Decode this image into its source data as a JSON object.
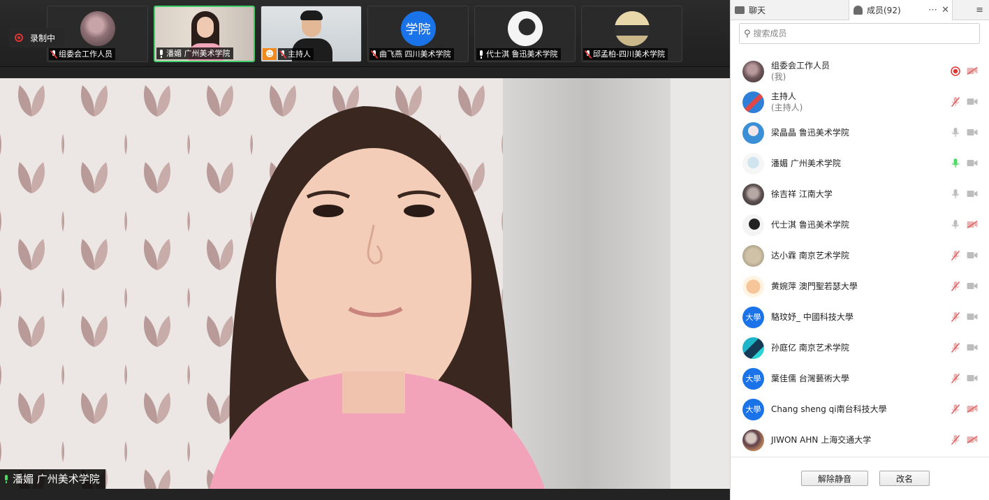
{
  "recording": {
    "label": "录制中"
  },
  "thumbnails": [
    {
      "name": "组委会工作人员",
      "mic": "muted",
      "avatar": "photo-dark"
    },
    {
      "name": "潘媚 广州美术学院",
      "mic": "on",
      "avatar": "photo-woman",
      "active": true
    },
    {
      "name": "主持人",
      "mic": "muted",
      "avatar": "photo-man",
      "host_badge": true
    },
    {
      "name": "曲飞燕 四川美术学院",
      "mic": "muted",
      "avatar": "text",
      "avatar_text": "学院"
    },
    {
      "name": "代士淇 鲁迅美术学院",
      "mic": "on",
      "avatar": "photo-bw"
    },
    {
      "name": "邱孟柏-四川美术学院",
      "mic": "muted",
      "avatar": "photo-device"
    }
  ],
  "main_video": {
    "speaker_label": "潘媚 广州美术学院"
  },
  "panel": {
    "tab_chat": "聊天",
    "tab_members": "成员(92)",
    "search_placeholder": "搜索成员",
    "members": [
      {
        "name": "组委会工作人员",
        "sub": "(我)",
        "mic": "recording",
        "cam": "muted",
        "avatar": "photo-dark"
      },
      {
        "name": "主持人",
        "sub": "(主持人)",
        "mic": "muted",
        "cam": "off",
        "avatar": "blue-red"
      },
      {
        "name": "梁晶晶 鲁迅美术学院",
        "mic": "off",
        "cam": "off",
        "avatar": "anime-blue"
      },
      {
        "name": "潘媚 广州美术学院",
        "mic": "active",
        "cam": "off",
        "avatar": "photo-light"
      },
      {
        "name": "徐吉祥 江南大学",
        "mic": "off",
        "cam": "off",
        "avatar": "photo-grey"
      },
      {
        "name": "代士淇 鲁迅美术学院",
        "mic": "off",
        "cam": "muted",
        "avatar": "photo-bw"
      },
      {
        "name": "达小霖 南京艺术学院",
        "mic": "muted",
        "cam": "off",
        "avatar": "photo-tan"
      },
      {
        "name": "黄婉萍 澳門聖若瑟大學",
        "mic": "muted",
        "cam": "off",
        "avatar": "cartoon"
      },
      {
        "name": "駱玟妤_ 中國科技大學",
        "mic": "muted",
        "cam": "off",
        "avatar": "text",
        "avatar_text": "大學"
      },
      {
        "name": "孙庭亿 南京艺术学院",
        "mic": "muted",
        "cam": "off",
        "avatar": "anime-teal"
      },
      {
        "name": "葉佳儒 台灣藝術大學",
        "mic": "muted",
        "cam": "off",
        "avatar": "text",
        "avatar_text": "大學"
      },
      {
        "name": "Chang sheng qi南台科技大學",
        "mic": "muted",
        "cam": "muted",
        "avatar": "text",
        "avatar_text": "大學"
      },
      {
        "name": "JIWON AHN 上海交通大学",
        "mic": "muted",
        "cam": "muted",
        "avatar": "photo-warm"
      }
    ],
    "btn_unmute_all": "解除静音",
    "btn_rename": "改名"
  },
  "colors": {
    "accent_green": "#3ecf6b",
    "record_red": "#e03535",
    "univ_blue": "#1a73e8"
  }
}
